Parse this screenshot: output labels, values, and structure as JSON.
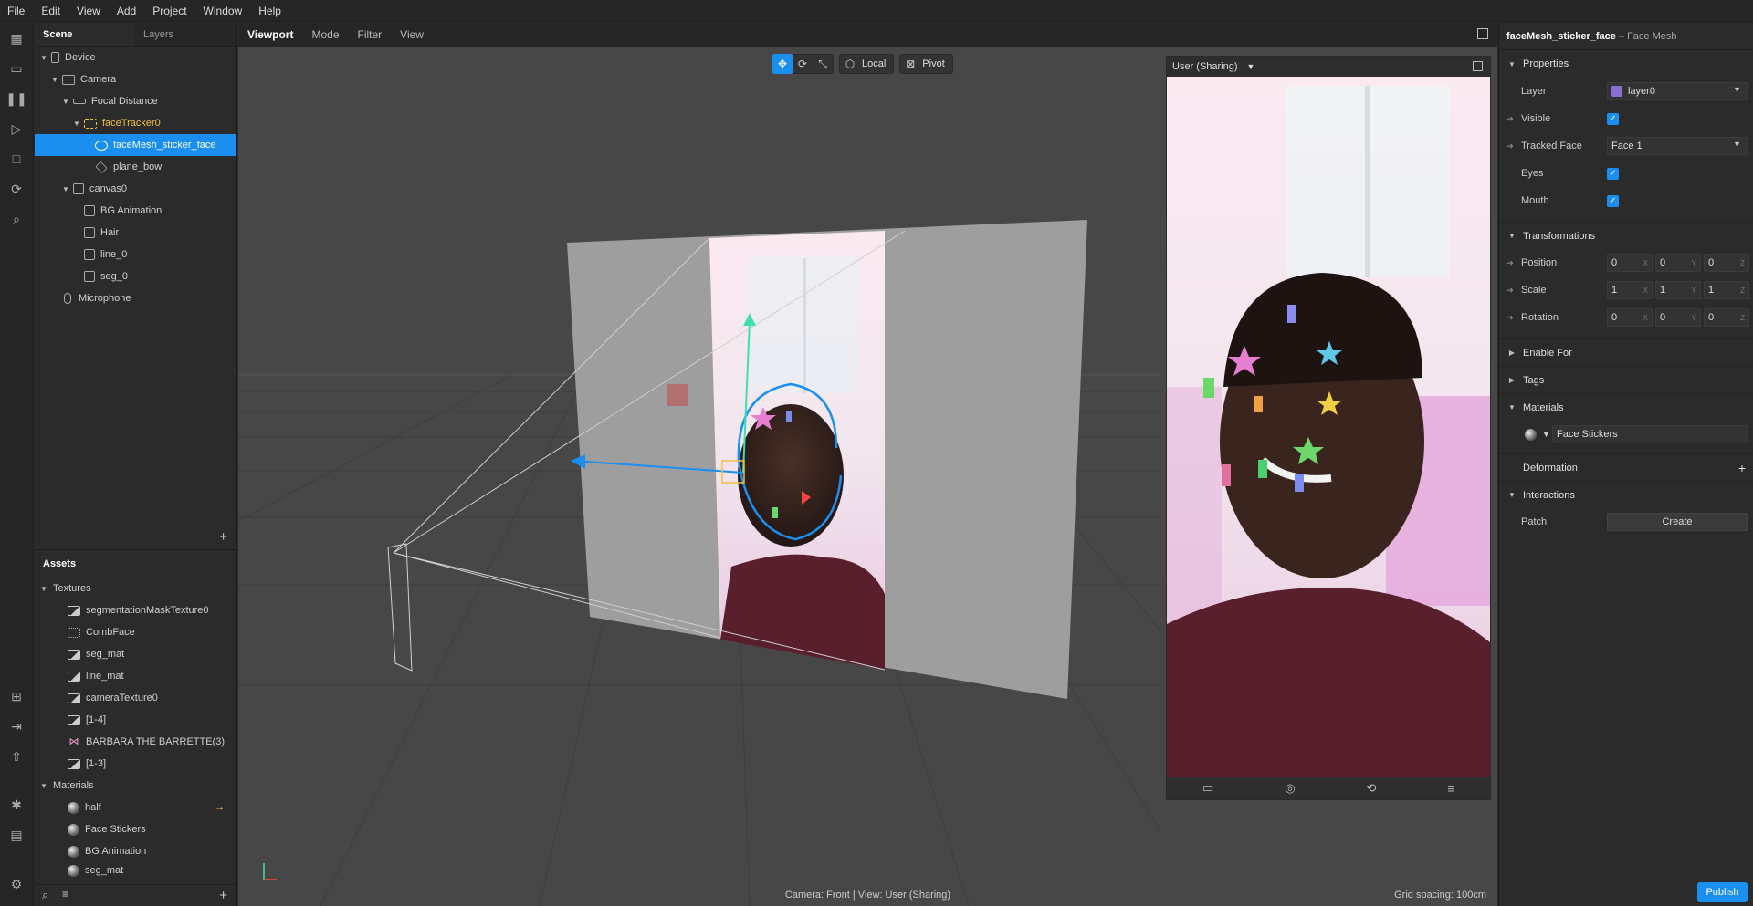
{
  "menu": [
    "File",
    "Edit",
    "View",
    "Add",
    "Project",
    "Window",
    "Help"
  ],
  "scene_panel": {
    "tabs": [
      "Scene",
      "Layers"
    ],
    "tree": [
      {
        "label": "Device",
        "indent": 0,
        "arrow": "▼",
        "icon": "device"
      },
      {
        "label": "Camera",
        "indent": 1,
        "arrow": "▼",
        "icon": "camera"
      },
      {
        "label": "Focal Distance",
        "indent": 2,
        "arrow": "▼",
        "icon": "focal"
      },
      {
        "label": "faceTracker0",
        "indent": 3,
        "arrow": "▼",
        "icon": "face"
      },
      {
        "label": "faceMesh_sticker_face",
        "indent": 4,
        "arrow": "",
        "icon": "mesh"
      },
      {
        "label": "plane_bow",
        "indent": 4,
        "arrow": "",
        "icon": "plane"
      },
      {
        "label": "canvas0",
        "indent": 2,
        "arrow": "▼",
        "icon": "canvas"
      },
      {
        "label": "BG Animation",
        "indent": 3,
        "arrow": "",
        "icon": "rect"
      },
      {
        "label": "Hair",
        "indent": 3,
        "arrow": "",
        "icon": "rect"
      },
      {
        "label": "line_0",
        "indent": 3,
        "arrow": "",
        "icon": "rect"
      },
      {
        "label": "seg_0",
        "indent": 3,
        "arrow": "",
        "icon": "rect"
      },
      {
        "label": "Microphone",
        "indent": 1,
        "arrow": "",
        "icon": "mic"
      }
    ]
  },
  "assets_panel": {
    "title": "Assets",
    "groups": [
      {
        "label": "Textures",
        "items": [
          "segmentationMaskTexture0",
          "CombFace",
          "seg_mat",
          "line_mat",
          "cameraTexture0",
          "[1-4]",
          "BARBARA THE BARRETTE(3)",
          "[1-3]"
        ]
      },
      {
        "label": "Materials",
        "items": [
          "half",
          "Face Stickers",
          "BG Animation",
          "seg_mat"
        ]
      }
    ]
  },
  "viewport": {
    "tabs": [
      "Viewport",
      "Mode",
      "Filter",
      "View"
    ],
    "toolbar": {
      "local": "Local",
      "pivot": "Pivot"
    },
    "preview_label": "User (Sharing)",
    "status": "Camera: Front | View: User (Sharing)",
    "grid": "Grid spacing: 100cm"
  },
  "inspector": {
    "title": "faceMesh_sticker_face",
    "subtitle": " – Face Mesh",
    "properties_header": "Properties",
    "layer_label": "Layer",
    "layer_value": "layer0",
    "visible_label": "Visible",
    "tracked_face_label": "Tracked Face",
    "tracked_face_value": "Face 1",
    "eyes_label": "Eyes",
    "mouth_label": "Mouth",
    "transformations_header": "Transformations",
    "position_label": "Position",
    "position": [
      "0",
      "0",
      "0"
    ],
    "scale_label": "Scale",
    "scale": [
      "1",
      "1",
      "1"
    ],
    "rotation_label": "Rotation",
    "rotation": [
      "0",
      "0",
      "0"
    ],
    "axes": [
      "X",
      "Y",
      "Z"
    ],
    "enable_for": "Enable For",
    "tags": "Tags",
    "materials_header": "Materials",
    "material_value": "Face Stickers",
    "deformation": "Deformation",
    "interactions_header": "Interactions",
    "patch_label": "Patch",
    "create_label": "Create",
    "publish_label": "Publish"
  },
  "colors": {
    "accent": "#1a8ff0",
    "highlight": "#f0c040",
    "layer_swatch": "#8a6fd0"
  }
}
